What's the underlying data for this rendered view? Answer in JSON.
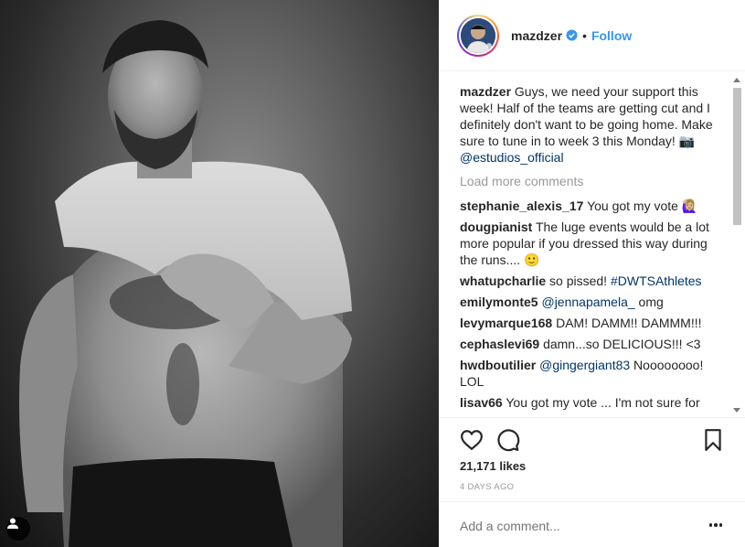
{
  "post": {
    "username": "mazdzer",
    "follow_label": "Follow",
    "separator": "•",
    "caption": {
      "username": "mazdzer",
      "text": "Guys, we need your support this week! Half of the teams are getting cut and I definitely don't want to be going home. Make sure to tune in to week 3 this Monday! 📷 ",
      "mention": "@estudios_official"
    },
    "load_more_label": "Load more comments",
    "comments": [
      {
        "user": "stephanie_alexis_17",
        "pre": "You got my vote 🙋🏼‍♀️",
        "mention": "",
        "post": ""
      },
      {
        "user": "dougpianist",
        "pre": "The luge events would be a lot more popular if you dressed this way during the runs.... 🙂",
        "mention": "",
        "post": ""
      },
      {
        "user": "whatupcharlie",
        "pre": "so pissed! ",
        "mention": "#DWTSAthletes",
        "post": ""
      },
      {
        "user": "emilymonte5",
        "pre": "",
        "mention": "@jennapamela_",
        "post": " omg"
      },
      {
        "user": "levymarque168",
        "pre": "DAM! DAMM!! DAMMM!!!",
        "mention": "",
        "post": ""
      },
      {
        "user": "cephaslevi69",
        "pre": "damn...so DELICIOUS!!! <3",
        "mention": "",
        "post": ""
      },
      {
        "user": "hwdboutilier",
        "pre": "",
        "mention": "@gingergiant83",
        "post": " Noooooooo! LOL"
      },
      {
        "user": "lisav66",
        "pre": "You got my vote ... I'm not sure for",
        "mention": "",
        "post": ""
      }
    ],
    "likes_text": "21,171 likes",
    "time_text": "4 DAYS AGO",
    "add_comment_placeholder": "Add a comment..."
  },
  "icons": {
    "like": "heart-icon",
    "comment": "comment-icon",
    "save": "bookmark-icon",
    "more": "more-options-icon",
    "tag": "user-tag-icon",
    "verified": "verified-badge-icon"
  },
  "colors": {
    "link": "#003569",
    "follow": "#3897f0",
    "muted": "#999999",
    "text": "#262626"
  }
}
